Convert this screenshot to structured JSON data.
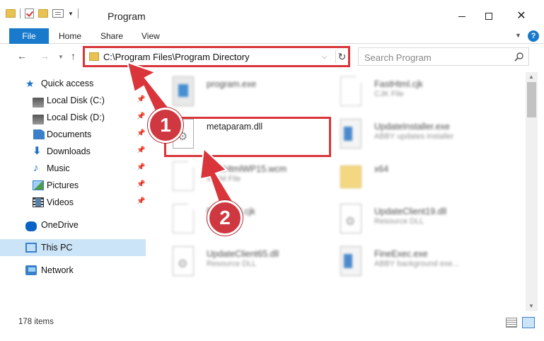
{
  "window": {
    "title": "Program"
  },
  "ribbon": {
    "tabs": [
      "File",
      "Home",
      "Share",
      "View"
    ],
    "help": "?"
  },
  "address": {
    "path": "C:\\Program Files\\Program Directory"
  },
  "search": {
    "placeholder": "Search Program"
  },
  "sidebar": {
    "items": [
      {
        "label": "Quick access",
        "icon": "star-icon"
      },
      {
        "label": "Local Disk (C:)",
        "icon": "disk-icon",
        "pinned": true
      },
      {
        "label": "Local Disk (D:)",
        "icon": "disk-icon",
        "pinned": true
      },
      {
        "label": "Documents",
        "icon": "documents-icon",
        "pinned": true
      },
      {
        "label": "Downloads",
        "icon": "downloads-icon",
        "pinned": true
      },
      {
        "label": "Music",
        "icon": "music-icon",
        "pinned": true
      },
      {
        "label": "Pictures",
        "icon": "pictures-icon",
        "pinned": true
      },
      {
        "label": "Videos",
        "icon": "videos-icon",
        "pinned": true
      },
      {
        "label": "OneDrive",
        "icon": "cloud-icon"
      },
      {
        "label": "This PC",
        "icon": "pc-icon",
        "selected": true
      },
      {
        "label": "Network",
        "icon": "network-icon"
      }
    ]
  },
  "files": [
    {
      "name": "program.exe",
      "type": "",
      "icon": "exe-icon",
      "blurred": true
    },
    {
      "name": "FastHtml.cjk",
      "type": "CJK File",
      "icon": "page-icon",
      "blurred": true
    },
    {
      "name": "metaparam.dll",
      "type": "",
      "icon": "dll-icon",
      "blurred": false
    },
    {
      "name": "UpdateInstaller.exe",
      "type": "ABBY updates installer",
      "icon": "installer-icon",
      "blurred": true
    },
    {
      "name": "FastHtmlWP15.wcm",
      "type": "WCM File",
      "icon": "page-icon",
      "blurred": true
    },
    {
      "name": "x64",
      "type": "",
      "icon": "folder-icon",
      "blurred": true
    },
    {
      "name": "FastHtml.cjk",
      "type": "CJK File",
      "icon": "page-icon",
      "blurred": true
    },
    {
      "name": "UpdateClient19.dll",
      "type": "Resource DLL",
      "icon": "dll-icon",
      "blurred": true
    },
    {
      "name": "UpdateClient65.dll",
      "type": "Resource DLL",
      "icon": "dll-icon",
      "blurred": true
    },
    {
      "name": "FineExec.exe",
      "type": "ABBY background exe...",
      "icon": "installer-icon",
      "blurred": true
    }
  ],
  "status": {
    "count": "178 items"
  },
  "annotations": {
    "badge1": "1",
    "badge2": "2",
    "color": "#d9353a"
  }
}
